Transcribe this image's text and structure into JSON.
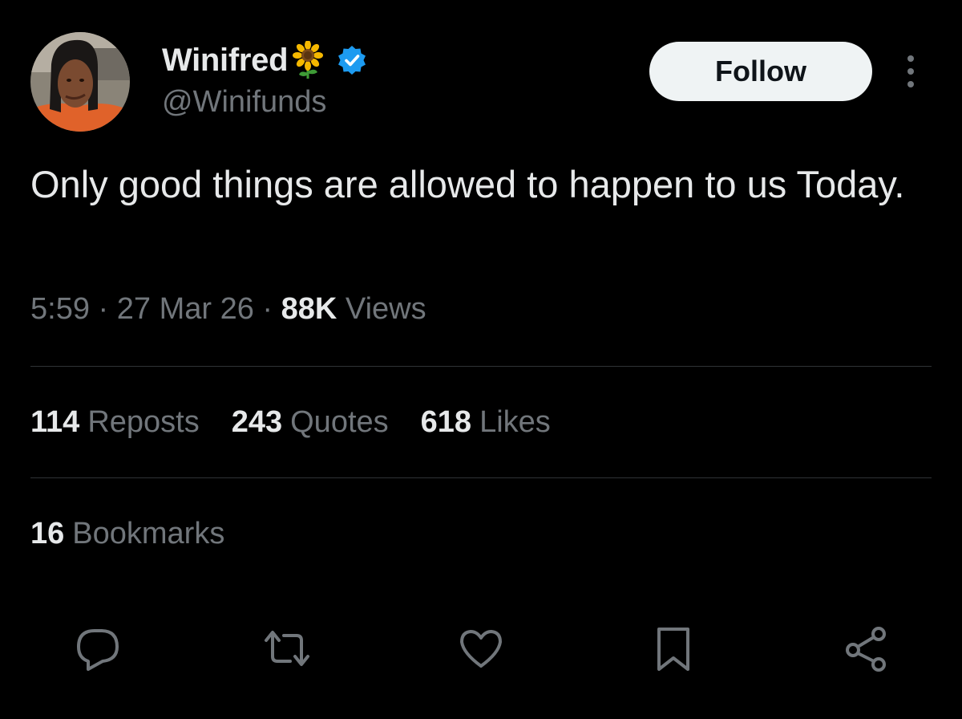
{
  "author": {
    "display_name": "Winifred",
    "name_emoji": "sunflower-emoji",
    "verified_badge": "verified-badge-icon",
    "handle": "@Winifunds",
    "avatar": "profile-photo"
  },
  "header": {
    "follow_label": "Follow",
    "more_icon": "more-vertical-icon"
  },
  "tweet": {
    "text": "Only good things are allowed to happen to us Today."
  },
  "meta": {
    "time": "5:59",
    "sep1": "·",
    "date": "27 Mar 26",
    "sep2": "·",
    "views_count": "88K",
    "views_label": "Views"
  },
  "stats": {
    "reposts_count": "114",
    "reposts_label": "Reposts",
    "quotes_count": "243",
    "quotes_label": "Quotes",
    "likes_count": "618",
    "likes_label": "Likes",
    "bookmarks_count": "16",
    "bookmarks_label": "Bookmarks"
  },
  "actions": [
    "reply-icon",
    "repost-icon",
    "like-icon",
    "bookmark-icon",
    "share-icon"
  ],
  "colors": {
    "background": "#000000",
    "primary_text": "#e7e9ea",
    "secondary_text": "#71767b",
    "divider": "#2f3336",
    "verified_blue": "#1d9bf0",
    "follow_bg": "#eff3f4"
  }
}
